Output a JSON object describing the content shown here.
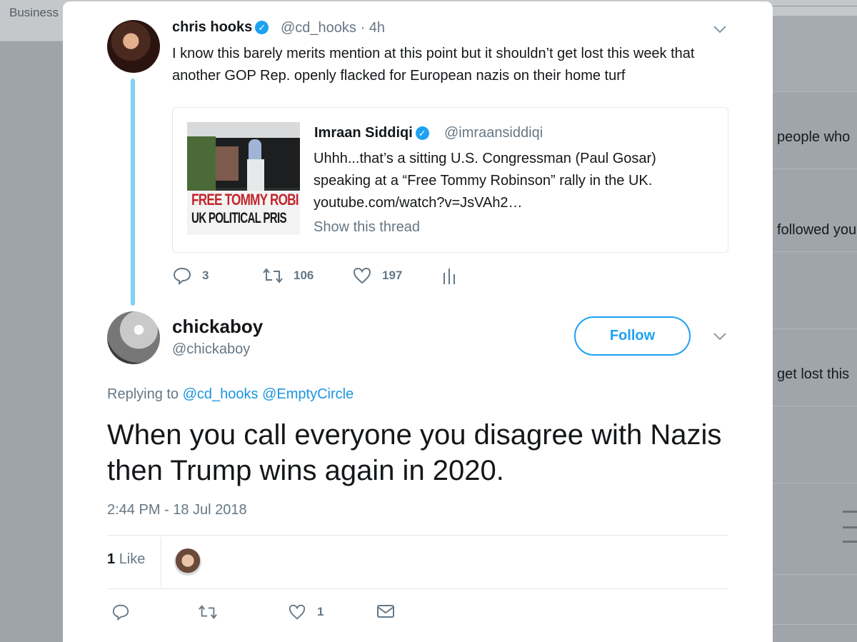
{
  "background": {
    "tab_label": "Business",
    "side_snippets": [
      "people who",
      "followed you",
      "get lost this"
    ]
  },
  "tweet": {
    "author_name": "chris hooks",
    "author_handle": "@cd_hooks",
    "time": "4h",
    "text": "I know this barely merits mention at this point but it shouldn’t get lost this week that another GOP Rep. openly flacked for European nazis on their home turf",
    "quoted": {
      "author_name": "Imraan Siddiqi",
      "author_handle": "@imraansiddiqi",
      "text_line1": "Uhhh...that’s a sitting U.S. Congressman (Paul Gosar)",
      "text_line2": "speaking at a “Free Tommy Robinson” rally in the UK.",
      "link": "youtube.com/watch?v=JsVAh2…",
      "show_thread": "Show this thread",
      "image_banner_line1": "FREE TOMMY ROBI",
      "image_banner_line2": "UK POLITICAL PRIS"
    },
    "replies": "3",
    "retweets": "106",
    "likes": "197"
  },
  "reply": {
    "author_name": "chickaboy",
    "author_handle": "@chickaboy",
    "follow_label": "Follow",
    "replying_to_prefix": "Replying to",
    "replying_to_1": "@cd_hooks",
    "replying_to_2": "@EmptyCircle",
    "text": "When you call everyone you disagree with Nazis then Trump wins again in 2020.",
    "timestamp": "2:44 PM - 18 Jul 2018",
    "like_count": "1",
    "like_label": "Like",
    "action_like_count": "1"
  },
  "colors": {
    "accent": "#1da1f2",
    "muted": "#657786",
    "thread_line": "#7fd3f4",
    "verified": "#1da1f2"
  }
}
